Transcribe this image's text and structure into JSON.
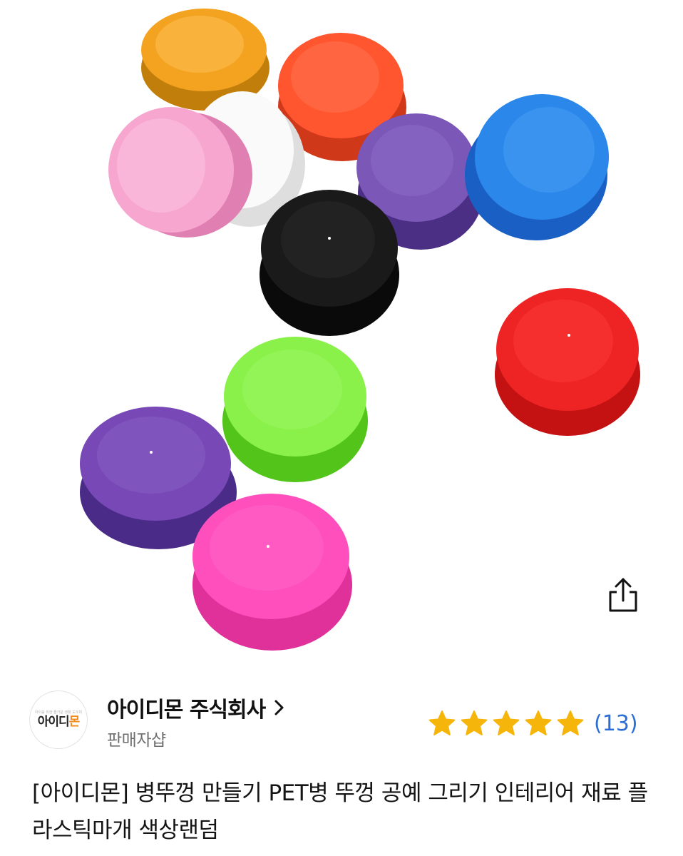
{
  "product_image": {
    "alt": "bottle caps"
  },
  "share": {
    "icon": "share-icon"
  },
  "seller": {
    "logo_tagline": "아이를 위한 즐거운 생활 도우미",
    "logo_text_a": "아이디",
    "logo_text_b": "몬",
    "name": "아이디몬 주식회사",
    "subtitle": "판매자샵"
  },
  "rating": {
    "stars": 5,
    "count": "(13)",
    "star_color": "#f5b50b",
    "count_color": "#2b6fd6"
  },
  "product": {
    "title": "[아이디몬] 병뚜껑 만들기 PET병 뚜껑 공예 그리기 인테리어 재료 플라스틱마개 색상랜덤"
  }
}
